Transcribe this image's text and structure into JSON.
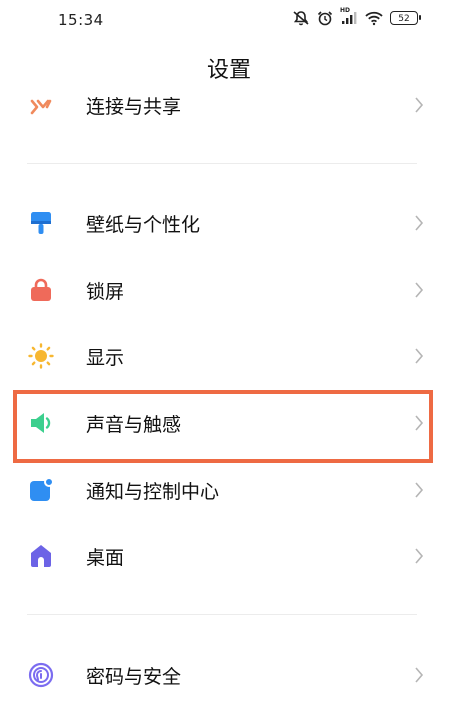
{
  "status_bar": {
    "time": "15:34",
    "hd_label": "HD",
    "battery": "52",
    "icons": [
      "mute-vibrate-icon",
      "alarm-icon",
      "signal-icon",
      "wifi-icon",
      "battery-icon"
    ]
  },
  "header": {
    "title": "设置"
  },
  "settings": {
    "items": [
      {
        "label": "连接与共享",
        "icon": "connection-share-icon",
        "color": "#f08a5d"
      },
      {
        "label": "壁纸与个性化",
        "icon": "wallpaper-icon",
        "color": "#2f8ef2"
      },
      {
        "label": "锁屏",
        "icon": "lock-icon",
        "color": "#ef6a5a"
      },
      {
        "label": "显示",
        "icon": "sun-icon",
        "color": "#f7b731"
      },
      {
        "label": "声音与触感",
        "icon": "speaker-icon",
        "color": "#3ccf8e"
      },
      {
        "label": "通知与控制中心",
        "icon": "notification-icon",
        "color": "#2f8ef2"
      },
      {
        "label": "桌面",
        "icon": "home-icon",
        "color": "#6c63e6"
      },
      {
        "label": "密码与安全",
        "icon": "fingerprint-icon",
        "color": "#7b6cf0"
      }
    ]
  },
  "highlight_color": "#ee6a43"
}
